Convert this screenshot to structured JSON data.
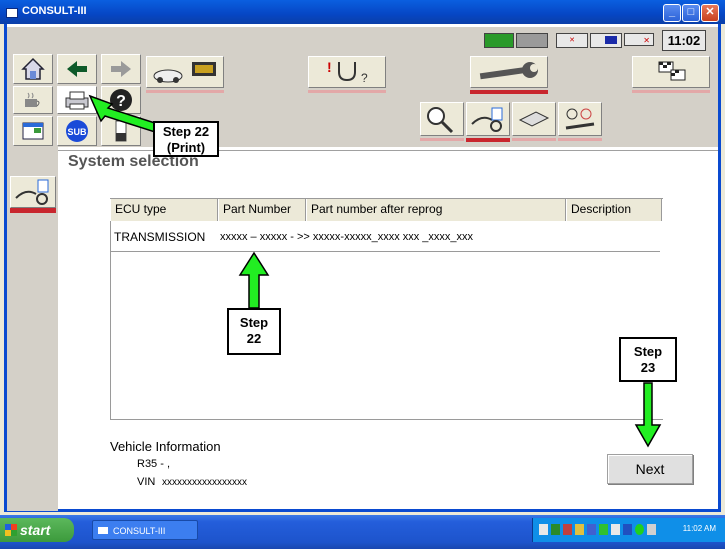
{
  "window": {
    "title": "CONSULT-III"
  },
  "status": {
    "time": "11:02",
    "indicators": [
      "vi-indicator",
      "signal-indicator",
      "lan-indicator",
      "monitor-indicator",
      "battery-indicator"
    ]
  },
  "page_title": "System selection",
  "table": {
    "headers": [
      "ECU type",
      "Part Number",
      "Part number after reprog",
      "Description"
    ],
    "rows": [
      {
        "ecu_type": "TRANSMISSION",
        "part_info": "xxxxx – xxxxx - >> xxxxx-xxxxx_xxxx xxx _xxxx_xxx"
      }
    ]
  },
  "vehicle": {
    "heading": "Vehicle Information",
    "model": "R35 - ,",
    "vin_label": "VIN",
    "vin": "xxxxxxxxxxxxxxxxx"
  },
  "next_label": "Next",
  "callouts": {
    "print_step": "Step 22",
    "print_sub": "(Print)",
    "table_step": "Step",
    "table_num": "22",
    "next_step": "Step",
    "next_num": "23"
  },
  "taskbar": {
    "start": "start",
    "item": "CONSULT-III",
    "time": "11:02 AM"
  },
  "colors": {
    "accent_red": "#c8262e",
    "arrow_green": "#22cc22",
    "titlebar_blue": "#0646c4"
  }
}
